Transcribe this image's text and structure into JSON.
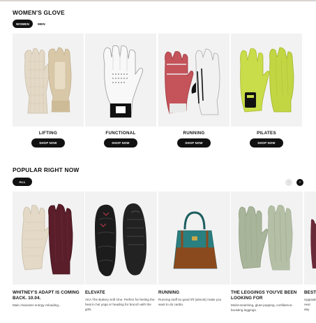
{
  "womens": {
    "title": "WOMEN'S GLOVE",
    "filters": [
      {
        "label": "WOMEN",
        "active": true
      },
      {
        "label": "MEN",
        "active": false
      }
    ],
    "categories": [
      {
        "name": "LIFTING",
        "button": "SHOP NOW",
        "icon": "crochet-lifting-glove-icon"
      },
      {
        "name": "FUNCTIONAL",
        "button": "SHOP NOW",
        "icon": "white-golf-glove-icon"
      },
      {
        "name": "RUNNING",
        "button": "SHOP NOW",
        "icon": "red-running-glove-icon"
      },
      {
        "name": "PILATES",
        "button": "SHOP NOW",
        "icon": "lime-pilates-glove-icon"
      }
    ]
  },
  "popular": {
    "title": "POPULAR RIGHT NOW",
    "filter": "ALL",
    "nav": {
      "prev": "‹",
      "next": "›"
    },
    "items": [
      {
        "title": "WHITNEY'S ADAPT IS COMING BACK. 10.04.",
        "desc": "Main character energy reloading...",
        "icon": "crochet-burgundy-glove-icon"
      },
      {
        "title": "ELEVATE",
        "desc": "AKA The Buttery Soft One. Perfect for feeling the heat in hot yoga or heading for brunch with the girls.",
        "icon": "black-shoes-icon"
      },
      {
        "title": "RUNNING",
        "desc": "Running stuff so good it'll (almost) make you want to do cardio.",
        "icon": "teal-handbag-icon"
      },
      {
        "title": "THE LEGGINGS YOU'VE BEEN LOOKING FOR",
        "desc": "Moist-snatching, glute-popping, confidence-boosting leggings.",
        "icon": "sage-gloves-icon"
      },
      {
        "title": "BEST",
        "desc": "Upgrade next day",
        "icon": "partial-product-icon"
      }
    ]
  },
  "colors": {
    "card_bg": "#f2f2f2",
    "black": "#111111",
    "crochet": "#e3d9c6",
    "leather_tan": "#d9c8a8",
    "burgundy": "#5a1e2a",
    "coral_red": "#c4535a",
    "lime": "#c9dc4a",
    "sage": "#a9b59a",
    "teal": "#2a7f80",
    "brown": "#8b4a1e"
  }
}
